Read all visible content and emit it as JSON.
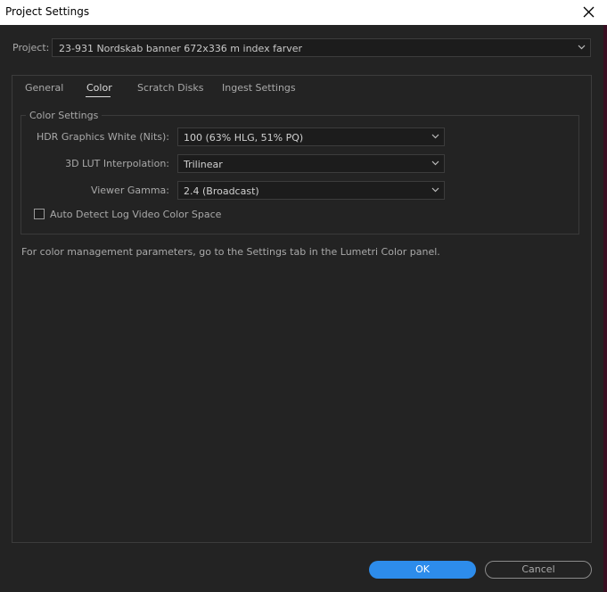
{
  "window": {
    "title": "Project Settings",
    "close_icon": "close-icon"
  },
  "project": {
    "label": "Project:",
    "value": "23-931 Nordskab banner 672x336 m index farver"
  },
  "tabs": [
    {
      "label": "General",
      "active": false
    },
    {
      "label": "Color",
      "active": true
    },
    {
      "label": "Scratch Disks",
      "active": false
    },
    {
      "label": "Ingest Settings",
      "active": false
    }
  ],
  "color_settings": {
    "group_title": "Color Settings",
    "fields": [
      {
        "label": "HDR Graphics White (Nits):",
        "value": "100 (63% HLG, 51% PQ)"
      },
      {
        "label": "3D LUT Interpolation:",
        "value": "Trilinear"
      },
      {
        "label": "Viewer Gamma:",
        "value": "2.4 (Broadcast)"
      }
    ],
    "auto_detect": {
      "label": "Auto Detect Log Video Color Space",
      "checked": false
    }
  },
  "info_text": "For color management parameters, go to the Settings tab in the Lumetri Color panel.",
  "buttons": {
    "ok": "OK",
    "cancel": "Cancel"
  },
  "colors": {
    "accent": "#2d8ceb",
    "background": "#232323"
  }
}
